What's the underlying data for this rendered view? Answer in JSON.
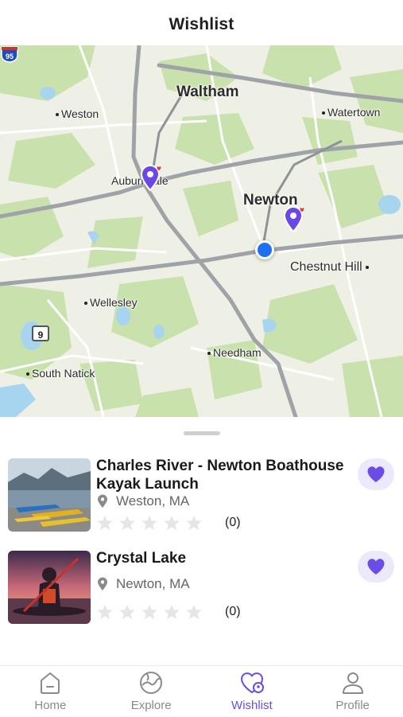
{
  "header": {
    "title": "Wishlist"
  },
  "map": {
    "labels": {
      "waltham": "Waltham",
      "weston": "Weston",
      "watertown": "Watertown",
      "auburndale": "Auburndale",
      "newton": "Newton",
      "chestnut_hill": "Chestnut Hill",
      "wellesley": "Wellesley",
      "needham": "Needham",
      "south_natick": "South Natick"
    },
    "shields": {
      "interstate": "95",
      "route": "9"
    },
    "colors": {
      "pin": "#6b46e8",
      "heart": "#e53935",
      "user_location": "#1f6ff2"
    }
  },
  "wishlist": [
    {
      "title": "Charles River - Newton Boathouse Kayak Launch",
      "location": "Weston, MA",
      "rating_count": "(0)",
      "stars": 0,
      "favorited": true
    },
    {
      "title": "Crystal Lake",
      "location": "Newton, MA",
      "rating_count": "(0)",
      "stars": 0,
      "favorited": true
    }
  ],
  "tabs": [
    {
      "label": "Home",
      "icon": "home-icon"
    },
    {
      "label": "Explore",
      "icon": "explore-icon"
    },
    {
      "label": "Wishlist",
      "icon": "wishlist-icon",
      "active": true
    },
    {
      "label": "Profile",
      "icon": "profile-icon"
    }
  ],
  "accent_color": "#6c4ce8"
}
